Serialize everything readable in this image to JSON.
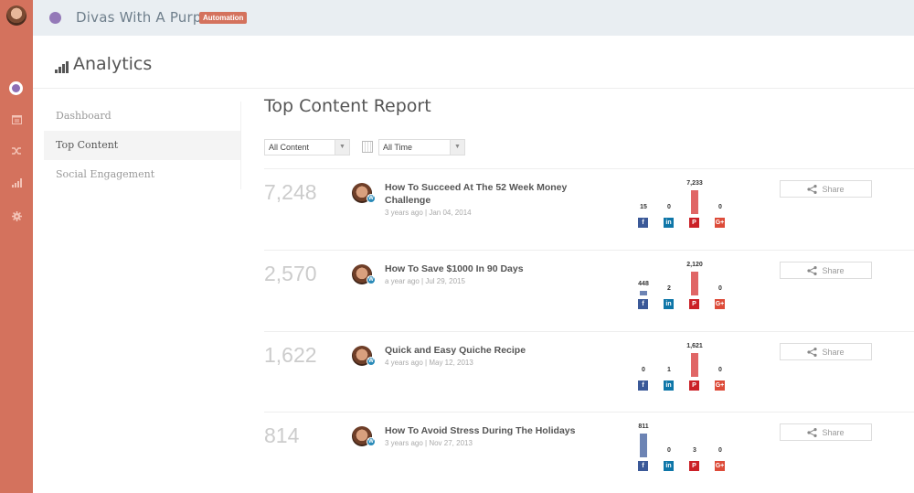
{
  "app": {
    "workspace_name": "Divas With A Purpose",
    "workspace_badge": "Automation",
    "section_title": "Analytics"
  },
  "rail": {
    "icons": [
      "avatar",
      "workspace-dot-icon",
      "calendar-icon",
      "shuffle-icon",
      "analytics-icon",
      "gear-icon"
    ]
  },
  "sidemenu": {
    "items": [
      {
        "label": "Dashboard",
        "active": false
      },
      {
        "label": "Top Content",
        "active": true
      },
      {
        "label": "Social Engagement",
        "active": false
      }
    ]
  },
  "report": {
    "title": "Top Content Report",
    "content_filter": "All Content",
    "time_filter": "All Time",
    "share_label": "Share"
  },
  "colors": {
    "accent": "#d4725d",
    "facebook": "#3b5998",
    "linkedin": "#0e76a8",
    "pinterest": "#cb2027",
    "googleplus": "#dd4b39",
    "pinterest_bar": "#e06666",
    "facebook_bar": "#6d84b4"
  },
  "posts": [
    {
      "views": "7,248",
      "title": "How To Succeed At The 52 Week Money Challenge",
      "meta": "3 years ago | Jan 04, 2014",
      "social": {
        "facebook": 15,
        "linkedin": 0,
        "pinterest": 7233,
        "googleplus": 0
      },
      "social_labels": {
        "facebook": "15",
        "linkedin": "0",
        "pinterest": "7,233",
        "googleplus": "0"
      }
    },
    {
      "views": "2,570",
      "title": "How To Save $1000 In 90 Days",
      "meta": "a year ago | Jul 29, 2015",
      "social": {
        "facebook": 448,
        "linkedin": 2,
        "pinterest": 2120,
        "googleplus": 0
      },
      "social_labels": {
        "facebook": "448",
        "linkedin": "2",
        "pinterest": "2,120",
        "googleplus": "0"
      }
    },
    {
      "views": "1,622",
      "title": "Quick and Easy Quiche Recipe",
      "meta": "4 years ago | May 12, 2013",
      "social": {
        "facebook": 0,
        "linkedin": 1,
        "pinterest": 1621,
        "googleplus": 0
      },
      "social_labels": {
        "facebook": "0",
        "linkedin": "1",
        "pinterest": "1,621",
        "googleplus": "0"
      }
    },
    {
      "views": "814",
      "title": "How To Avoid Stress During The Holidays",
      "meta": "3 years ago | Nov 27, 2013",
      "social": {
        "facebook": 811,
        "linkedin": 0,
        "pinterest": 3,
        "googleplus": 0
      },
      "social_labels": {
        "facebook": "811",
        "linkedin": "0",
        "pinterest": "3",
        "googleplus": "0"
      }
    }
  ]
}
